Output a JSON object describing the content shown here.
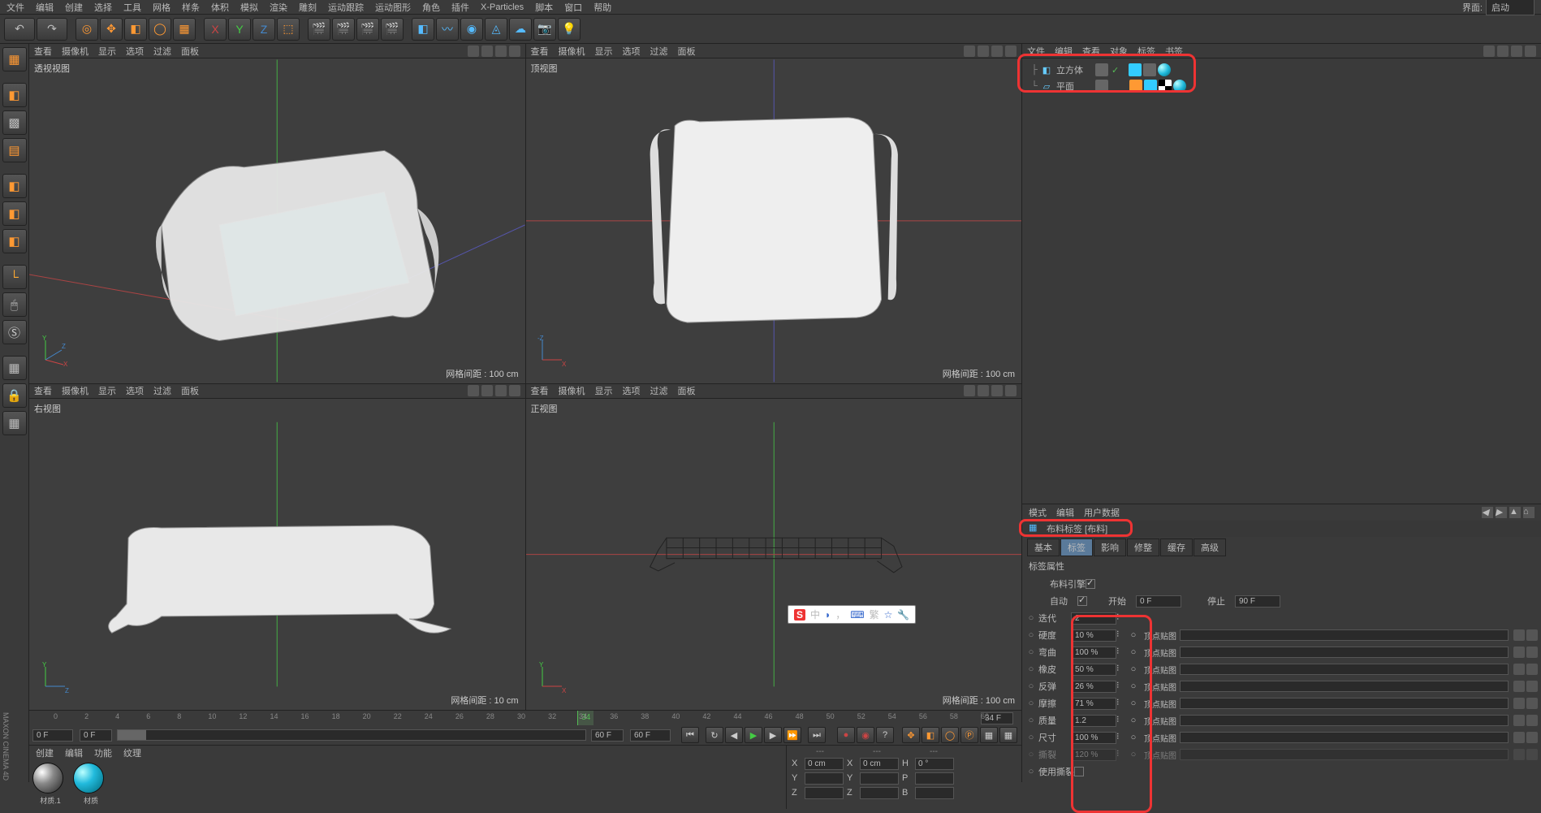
{
  "menu": {
    "items": [
      "文件",
      "编辑",
      "创建",
      "选择",
      "工具",
      "网格",
      "样条",
      "体积",
      "模拟",
      "渲染",
      "雕刻",
      "运动跟踪",
      "运动图形",
      "角色",
      "插件",
      "X-Particles",
      "脚本",
      "窗口",
      "帮助"
    ],
    "layout_label": "界面:",
    "layout_value": "启动"
  },
  "viewport_menu": {
    "items": [
      "查看",
      "摄像机",
      "显示",
      "选项",
      "过滤",
      "面板"
    ]
  },
  "viewports": {
    "tl": {
      "label": "透视视图",
      "grid": "网格间距 : 100 cm"
    },
    "tr": {
      "label": "顶视图",
      "grid": "网格间距 : 100 cm"
    },
    "bl": {
      "label": "右视图",
      "grid": "网格间距 : 10 cm"
    },
    "br": {
      "label": "正视图",
      "grid": "网格间距 : 100 cm"
    }
  },
  "timeline": {
    "start": "0 F",
    "slider_start": "0 F",
    "slider_end": "60 F",
    "end": "60 F",
    "current": "34",
    "end_display": "34 F",
    "ticks": [
      "0",
      "2",
      "4",
      "6",
      "8",
      "10",
      "12",
      "14",
      "16",
      "18",
      "20",
      "22",
      "24",
      "26",
      "28",
      "30",
      "32",
      "34",
      "36",
      "38",
      "40",
      "42",
      "44",
      "46",
      "48",
      "50",
      "52",
      "54",
      "56",
      "58",
      "60"
    ]
  },
  "bottom_menu": [
    "创建",
    "编辑",
    "功能",
    "纹理"
  ],
  "materials": [
    {
      "name": "材质.1",
      "type": "gray"
    },
    {
      "name": "材质",
      "type": "cyan"
    }
  ],
  "obj_panel": {
    "menu": [
      "文件",
      "编辑",
      "查看",
      "对象",
      "标签",
      "书签"
    ],
    "items": [
      {
        "name": "立方体",
        "icon": "cube"
      },
      {
        "name": "平面",
        "icon": "plane"
      }
    ]
  },
  "attr": {
    "menu": [
      "模式",
      "编辑",
      "用户数据"
    ],
    "title": "布料标签 [布料]",
    "tabs": [
      "基本",
      "标签",
      "影响",
      "修整",
      "缓存",
      "高级"
    ],
    "active_tab": 1,
    "group": "标签属性",
    "engine_label": "布料引擎",
    "auto_label": "自动",
    "start_label": "开始",
    "start_value": "0 F",
    "stop_label": "停止",
    "stop_value": "90 F",
    "rows": [
      {
        "label": "迭代",
        "value": "2",
        "map": false
      },
      {
        "label": "硬度",
        "value": "10 %",
        "map": true
      },
      {
        "label": "弯曲",
        "value": "100 %",
        "map": true
      },
      {
        "label": "橡皮",
        "value": "50 %",
        "map": true
      },
      {
        "label": "反弹",
        "value": "26 %",
        "map": true
      },
      {
        "label": "摩擦",
        "value": "71 %",
        "map": true
      },
      {
        "label": "质量",
        "value": "1.2",
        "map": true
      },
      {
        "label": "尺寸",
        "value": "100 %",
        "map": true
      },
      {
        "label": "撕裂",
        "value": "120 %",
        "map": true,
        "disabled": true
      }
    ],
    "vertex_map_label": "顶点贴图",
    "use_tear_label": "使用撕裂"
  },
  "coord": {
    "headers": [
      "---",
      "---",
      "---"
    ],
    "x": {
      "pos": "0 cm",
      "x": "0 cm",
      "h": "0 °"
    },
    "y": {},
    "d": {}
  },
  "ime": {
    "letter": "中"
  }
}
